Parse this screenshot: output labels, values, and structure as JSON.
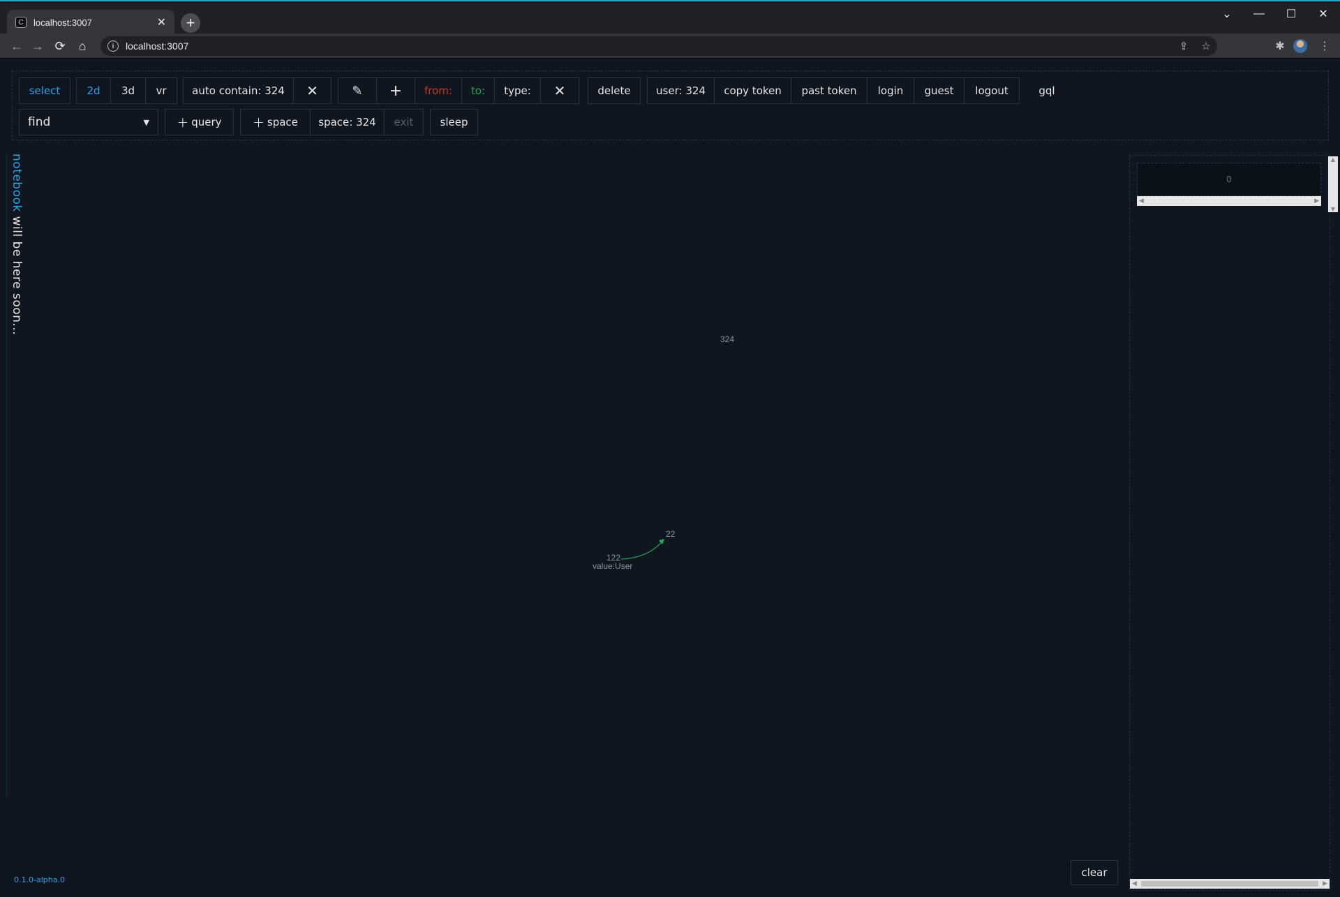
{
  "browser": {
    "tab_title": "localhost:3007",
    "tab_close": "✕",
    "new_tab": "+",
    "url": "localhost:3007",
    "info_glyph": "i"
  },
  "toolbar": {
    "row1": {
      "select": "select",
      "mode_2d": "2d",
      "mode_3d": "3d",
      "mode_vr": "vr",
      "auto_contain": "auto contain: 324",
      "from": "from:",
      "to": "to:",
      "type": "type:",
      "delete": "delete",
      "user": "user: 324",
      "copy_token": "copy token",
      "past_token": "past token",
      "login": "login",
      "guest": "guest",
      "logout": "logout",
      "gql": "gql"
    },
    "row2": {
      "find": "find",
      "query": "query",
      "add_space": "space",
      "space": "space: 324",
      "exit": "exit",
      "sleep": "sleep"
    }
  },
  "notebook": {
    "word": "notebook",
    "rest": " will be here soon..."
  },
  "graph": {
    "root_label": "324",
    "node_a_id": "122",
    "node_a_value": "value:User",
    "node_b_id": "22",
    "edge_color": "#1fa856"
  },
  "side_panel": {
    "count": "0"
  },
  "footer": {
    "clear": "clear",
    "version": "0.1.0-alpha.0"
  },
  "colors": {
    "accent_blue": "#2aa3e8",
    "from_red": "#c0392b",
    "to_green": "#1fa856",
    "background": "#0f1620"
  }
}
